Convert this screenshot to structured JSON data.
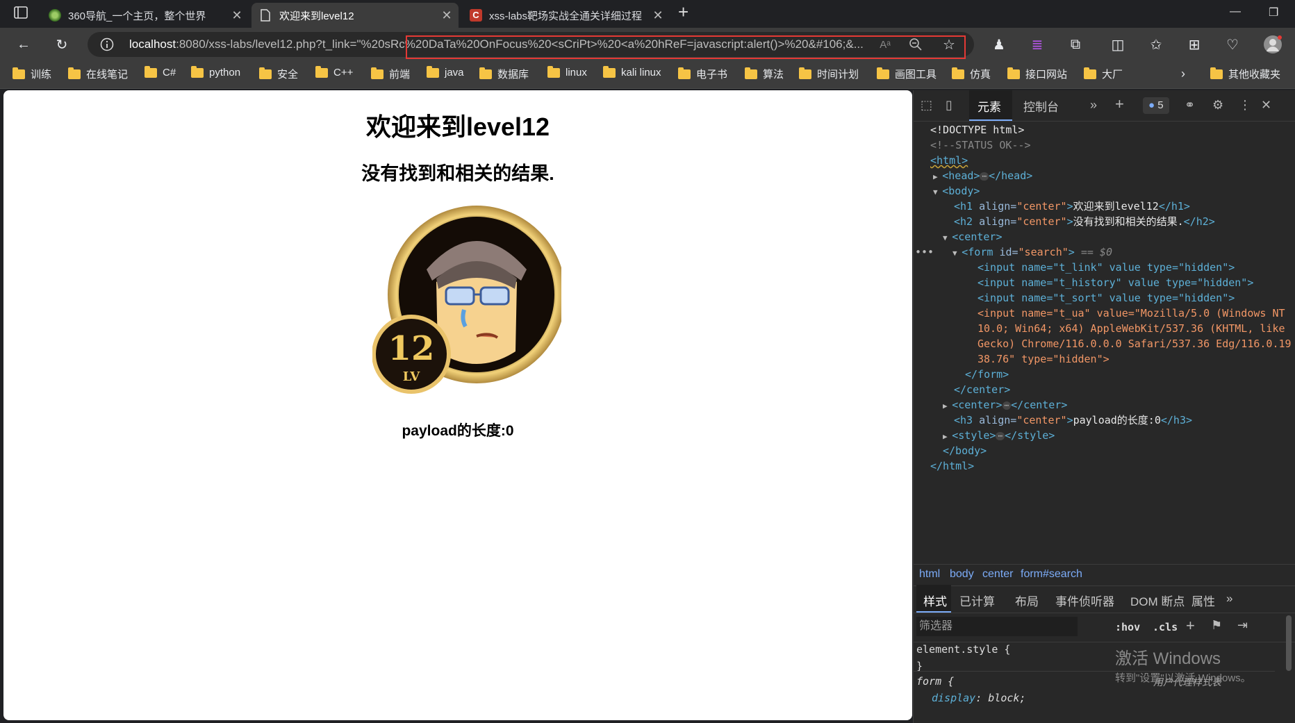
{
  "tabs": [
    {
      "title": "360导航_一个主页，整个世界",
      "icon": "360-globe-icon",
      "active": false
    },
    {
      "title": "欢迎来到level12",
      "icon": "page-icon",
      "active": true
    },
    {
      "title": "xss-labs靶场实战全通关详细过程",
      "icon": "csdn-c-icon",
      "active": false
    }
  ],
  "address_bar": {
    "host": "localhost",
    "path": ":8080/xss-labs/level12.php",
    "query": "?t_link=\"%20sRc%20DaTa%20OnFocus%20<sCriPt>%20<a%20hReF=javascript:alert()>%20&#106;&..."
  },
  "bookmarks": [
    "训练",
    "在线笔记",
    "C#",
    "python",
    "安全",
    "C++",
    "前端",
    "java",
    "数据库",
    "linux",
    "kali linux",
    "电子书",
    "算法",
    "时间计划",
    "画图工具",
    "仿真",
    "接口网站",
    "大厂"
  ],
  "bookmarks_other": "其他收藏夹",
  "page": {
    "h1": "欢迎来到level12",
    "h2": "没有找到和相关的结果.",
    "badge_level": "12",
    "badge_lv": "LV",
    "h3": "payload的长度:0"
  },
  "devtools": {
    "tabs": {
      "elements": "元素",
      "console": "控制台"
    },
    "issues_count": "5",
    "dom": {
      "doctype": "<!DOCTYPE html>",
      "comment": "<!--STATUS OK-->",
      "html_open": "<html>",
      "head": "<head>",
      "head_close": "</head>",
      "body_open": "<body>",
      "h1_open": "<h1",
      "h1_attr": "align",
      "h1_val": "\"center\"",
      "h1_text": "欢迎来到level12",
      "h1_close": "</h1>",
      "h2_open": "<h2",
      "h2_attr": "align",
      "h2_val": "\"center\"",
      "h2_text": "没有找到和相关的结果.",
      "h2_close": "</h2>",
      "center_open": "<center>",
      "form_open": "<form",
      "form_attr": "id",
      "form_val": "\"search\"",
      "selected_marker": "== $0",
      "input1": "<input name=\"t_link\" value type=\"hidden\">",
      "input2": "<input name=\"t_history\" value type=\"hidden\">",
      "input3": "<input name=\"t_sort\" value type=\"hidden\">",
      "input4_a": "<input name=\"t_ua\" value=\"Mozilla/5.0 (Windows NT",
      "input4_b": "10.0; Win64; x64) AppleWebKit/537.36 (KHTML, like",
      "input4_c": "Gecko) Chrome/116.0.0.0 Safari/537.36 Edg/116.0.19",
      "input4_d": "38.76\" type=\"hidden\">",
      "form_close": "</form>",
      "center_close": "</center>",
      "center2_open": "<center>",
      "center2_close": "</center>",
      "h3_open": "<h3",
      "h3_attr": "align",
      "h3_val": "\"center\"",
      "h3_text": "payload的长度:0",
      "h3_close": "</h3>",
      "style_open": "<style>",
      "style_close": "</style>",
      "body_close": "</body>",
      "html_close": "</html>"
    },
    "breadcrumb": [
      "html",
      "body",
      "center",
      "form#search"
    ],
    "styles_tabs": [
      "样式",
      "已计算",
      "布局",
      "事件侦听器",
      "DOM 断点",
      "属性"
    ],
    "filter_placeholder": "筛选器",
    "hov": ":hov",
    "cls": ".cls",
    "element_style": "element.style {",
    "close_brace": "}",
    "form_rule": "form {",
    "ua_label": "用户代理样式表",
    "display_prop": "display",
    "display_val": "block;"
  },
  "watermark": {
    "line1": "激活 Windows",
    "line2": "转到\"设置\"以激活 Windows。"
  }
}
